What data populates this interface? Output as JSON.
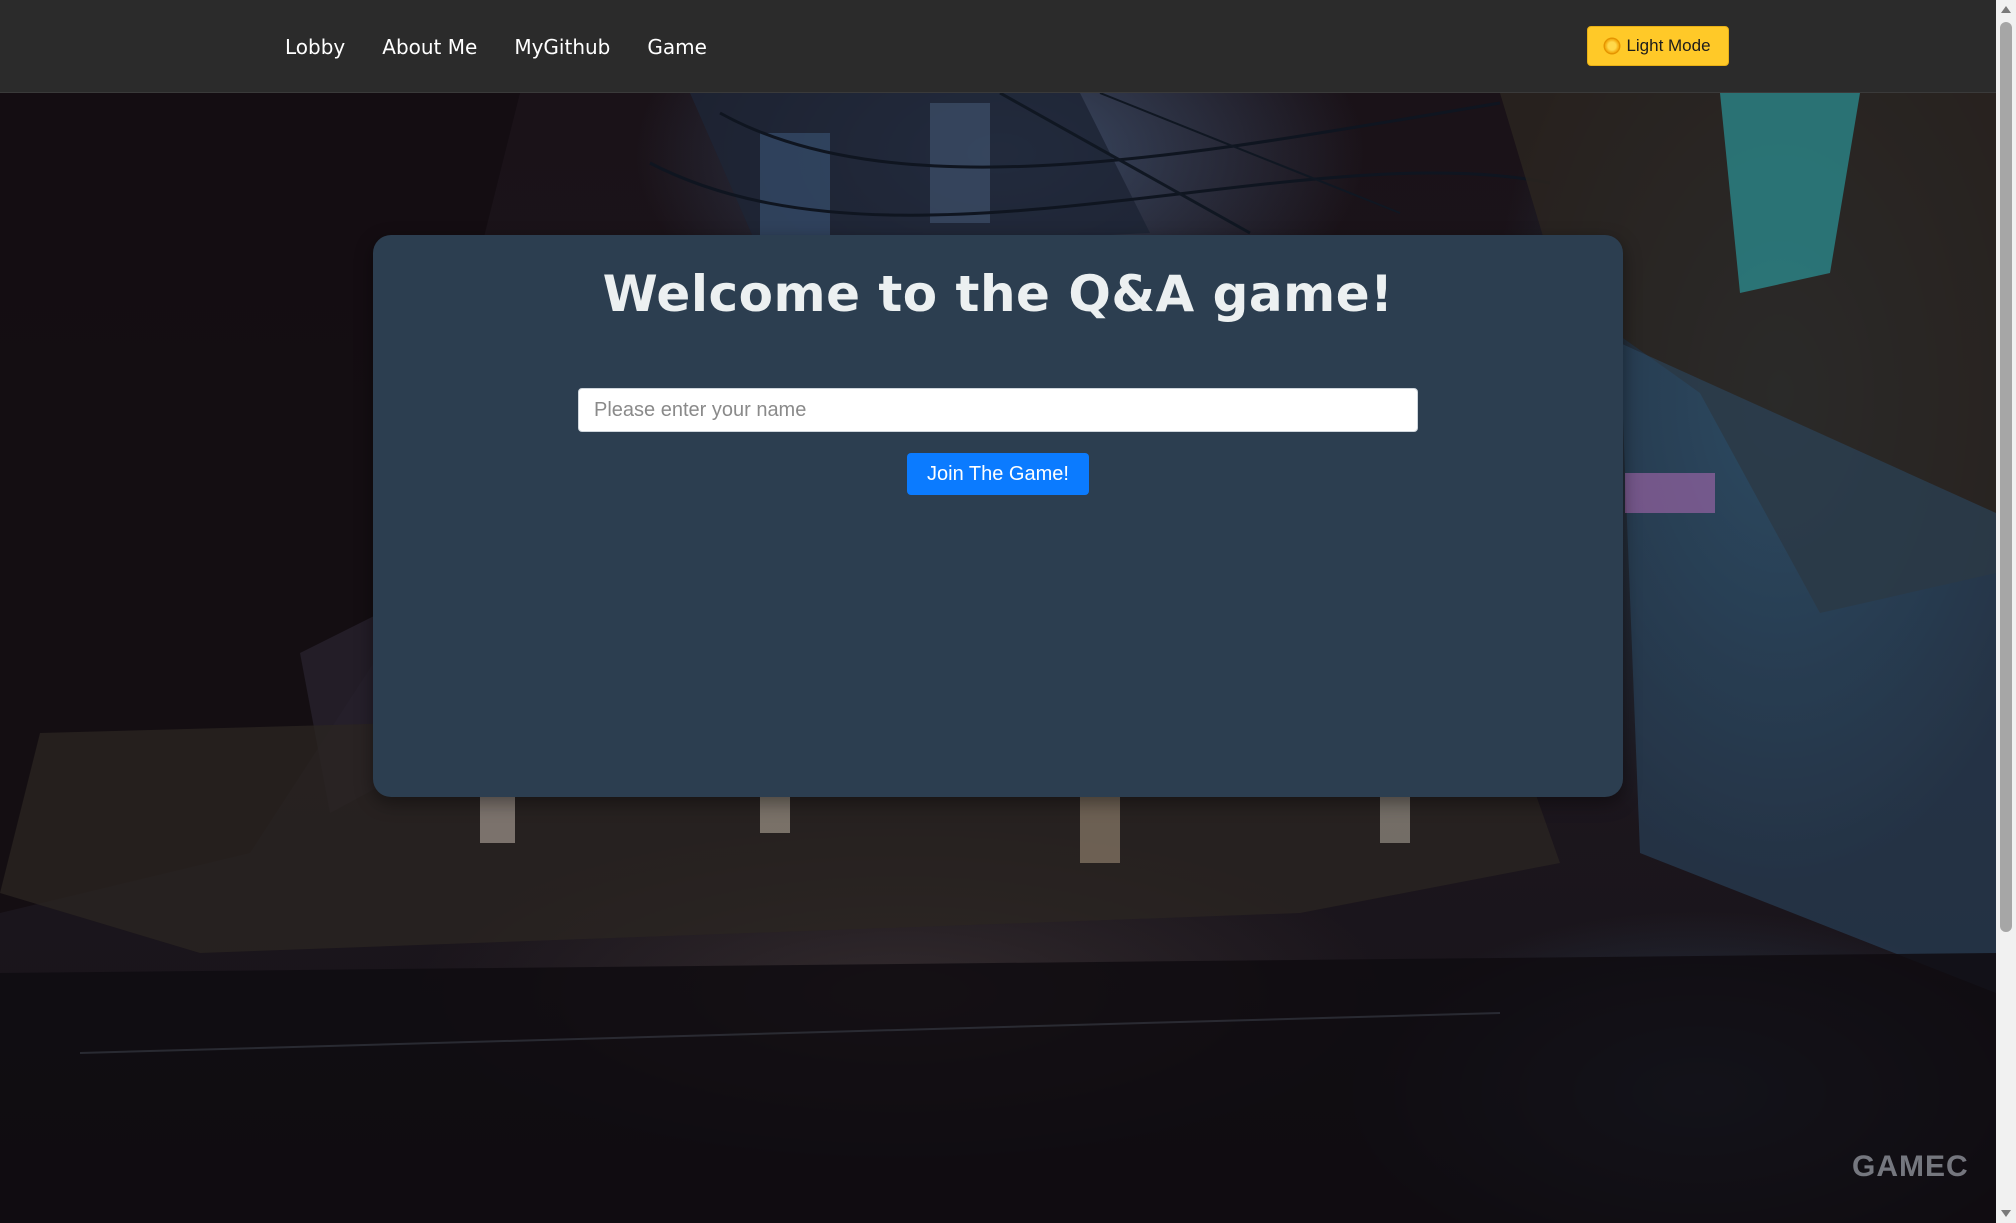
{
  "nav": {
    "items": [
      {
        "label": "Lobby"
      },
      {
        "label": "About Me"
      },
      {
        "label": "MyGithub"
      },
      {
        "label": "Game"
      }
    ],
    "theme_toggle": {
      "label": "Light Mode",
      "icon": "sun-icon"
    }
  },
  "main": {
    "title": "Welcome to the Q&A game!",
    "name_input": {
      "placeholder": "Please enter your name",
      "value": ""
    },
    "join_button": "Join The Game!"
  },
  "background": {
    "watermark": "GAMEC"
  },
  "colors": {
    "navbar": "#2b2b2b",
    "card": "#2c3e50",
    "accent_yellow": "#ffc928",
    "primary_button": "#0b7bff"
  }
}
